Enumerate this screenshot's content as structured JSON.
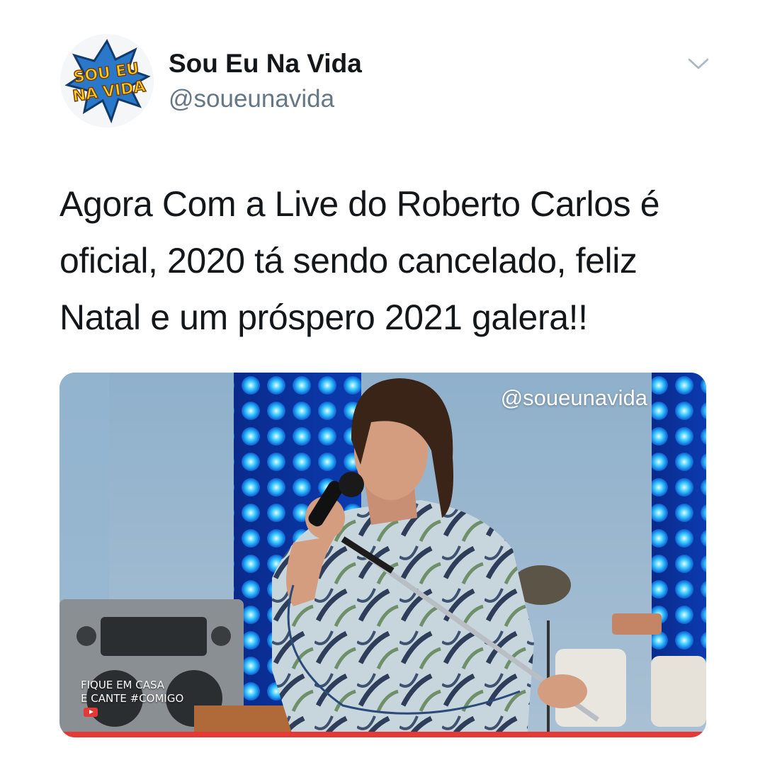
{
  "account": {
    "name": "Sou Eu Na Vida",
    "handle": "@soueunavida",
    "avatar_logo_text": [
      "SOU EU",
      "NA VIDA"
    ]
  },
  "tweet": {
    "text": "Agora Com a Live do Roberto Carlos é oficial, 2020 tá sendo cancelado, feliz Natal e um próspero 2021 galera!!"
  },
  "media": {
    "watermark": "@soueunavida",
    "overlay_line1": "Fique em casa",
    "overlay_line2": "e cante #comigo"
  },
  "icons": {
    "menu": "chevron-down-icon",
    "overlay_badge": "youtube-icon"
  },
  "colors": {
    "handle_gray": "#657786",
    "chevron_gray": "#aab8c2",
    "stage_led_blue": "#1a7cff",
    "progress_red": "#e53935"
  }
}
